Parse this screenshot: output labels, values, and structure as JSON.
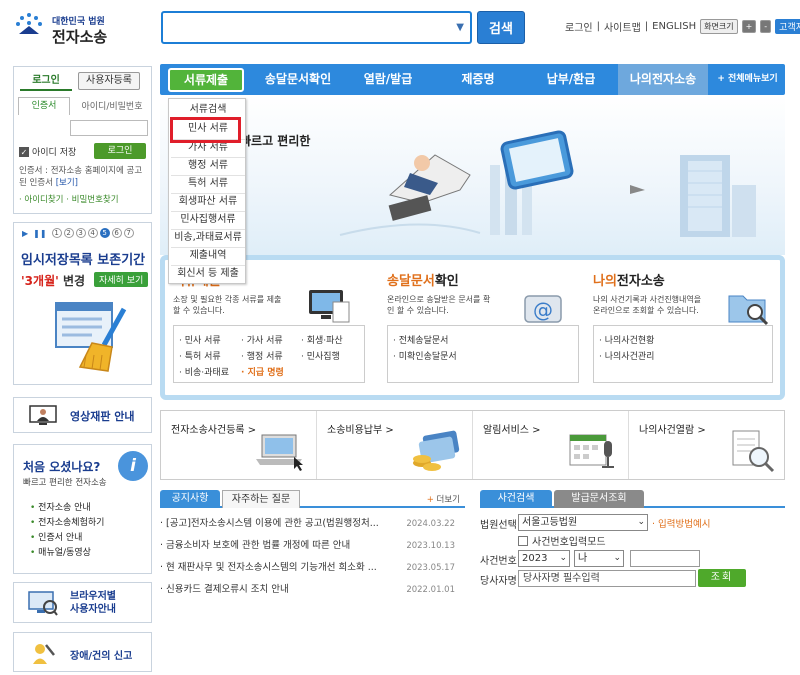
{
  "header": {
    "logo_line1": "대한민국 법원",
    "logo_line2": "전자소송",
    "search_placeholder": "",
    "search_button": "검색",
    "links": [
      "로그인",
      "|",
      "사이트맵",
      "|",
      "ENGLISH"
    ],
    "font_size_label": "화면크기",
    "font_plus": "+",
    "font_minus": "-",
    "customer_center": "고객지원센터"
  },
  "login": {
    "tab_login": "로그인",
    "tab_register": "사용자등록",
    "sub_tab_cert": "인증서",
    "sub_tab_idpw": "아이디/비밀번호",
    "save_id": "아이디 저장",
    "login_button": "로그인",
    "cert_note": "인증서 : 전자소송 홈페이지에 공고된 인증서",
    "cert_note_link": "[보기]",
    "find_id": "· 아이디찾기",
    "find_pw": "· 비밀번호찾기"
  },
  "temp_save": {
    "pages": [
      "1",
      "2",
      "3",
      "4",
      "5",
      "6",
      "7"
    ],
    "active_page": "5",
    "title": "임시저장목록 보존기간",
    "months": "'3개월'",
    "changed": "변경",
    "detail": "자세히 보기"
  },
  "video_trial": "영상재판 안내",
  "first_visit": {
    "title": "처음 오셨나요?",
    "subtitle": "빠르고 편리한 전자소송",
    "icon": "i",
    "links": [
      "전자소송 안내",
      "전자소송체험하기",
      "인증서 안내",
      "매뉴얼/동영상"
    ]
  },
  "browser_guide": [
    "브라우저별",
    "사용자안내"
  ],
  "report": "장애/건의 신고",
  "nav": {
    "items": [
      "서류제출",
      "송달문서확인",
      "열람/발급",
      "제증명",
      "납부/환급",
      "나의전자소송"
    ],
    "all_menu": "+ 전체메뉴보기"
  },
  "dropdown": {
    "items": [
      "서류검색",
      "민사 서류",
      "가사 서류",
      "행정 서류",
      "특허 서류",
      "회생파산 서류",
      "민사집행서류",
      "비송,과태료서류",
      "제출내역",
      "회신서 등 제출"
    ],
    "highlighted": "민사 서류"
  },
  "hero_text": "빠르고 편리한",
  "panel": {
    "submit": {
      "title_hl": "서류제출",
      "title_rest": "",
      "desc": "소장 및 필요한 각종 서류를 제출할 수 있습니다.",
      "links": [
        "민사 서류",
        "가사 서류",
        "회생·파산",
        "특허 서류",
        "행정 서류",
        "민사집행",
        "비송·과태료",
        "지급 명령"
      ]
    },
    "delivery": {
      "title_hl": "송달문서",
      "title_rest": "확인",
      "desc": "온라인으로 송달받은 문서를 확인 할 수 있습니다.",
      "links": [
        "전체송달문서",
        "미확인송달문서"
      ]
    },
    "mine": {
      "title_hl": "나의",
      "title_rest": "전자소송",
      "desc": "나의 사건기록과 사건진행내역을 온라인으로 조회할 수 있습니다.",
      "links": [
        "나의사건현황",
        "나의사건관리"
      ]
    }
  },
  "quick": [
    "전자소송사건등록 >",
    "소송비용납부 >",
    "알림서비스 >",
    "나의사건열람 >"
  ],
  "notices": {
    "tab_notice": "공지사항",
    "tab_faq": "자주하는 질문",
    "more": "더보기",
    "more_plus": "+",
    "rows": [
      {
        "text": "· [공고]전자소송시스템 이용에 관한 공고(법원행정처...",
        "date": "2024.03.22"
      },
      {
        "text": "· 금융소비자 보호에 관한 법률 개정에 따른 안내",
        "date": "2023.10.13"
      },
      {
        "text": "· 현 재판사무 및 전자소송시스템의 기능개선 희소화 ...",
        "date": "2023.05.17"
      },
      {
        "text": "· 신용카드 결제오류시 조치 안내",
        "date": "2022.01.01"
      }
    ]
  },
  "case_search": {
    "tab_search": "사건검색",
    "tab_issue": "발급문서조회",
    "court_label": "법원선택",
    "court_value": "서울고등법원",
    "guide": "· 입력방법예시",
    "case_input_mode": "사건번호입력모드",
    "case_no_label": "사건번호",
    "year": "2023",
    "kind": "나",
    "party_label": "당사자명",
    "party_placeholder": "당사자명 필수입력",
    "inquiry": "조회"
  }
}
